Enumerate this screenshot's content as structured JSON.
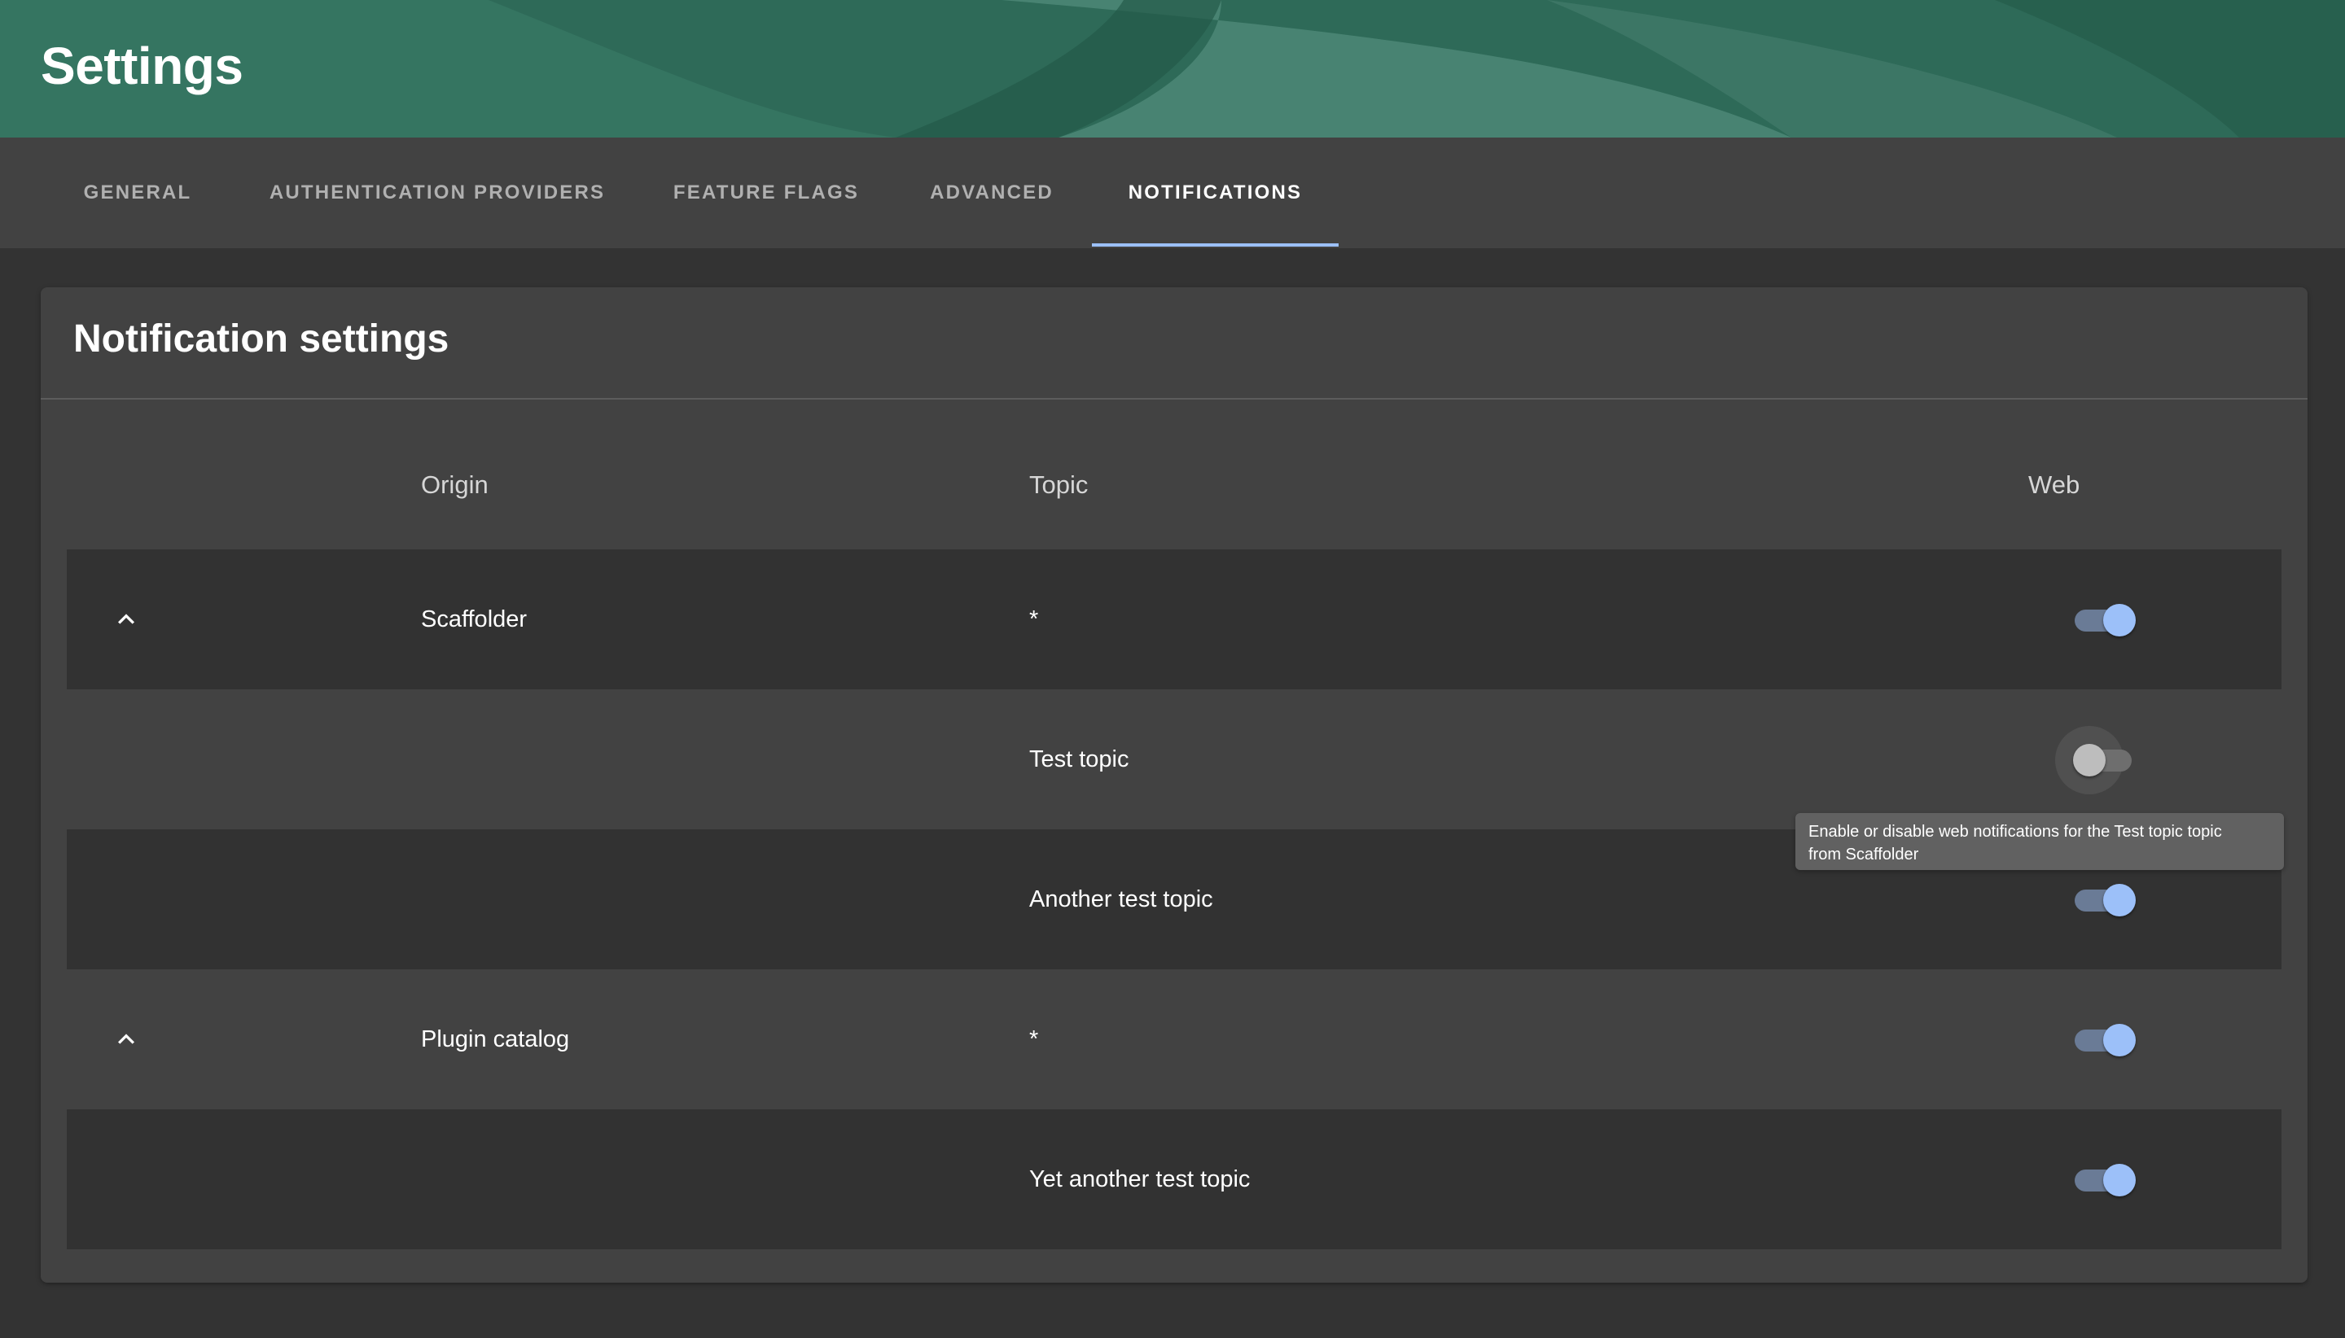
{
  "colors": {
    "header_bg": "#2e6a58",
    "accent": "#9cc0f9",
    "page_bg": "#333333",
    "card_bg": "#424242"
  },
  "header": {
    "title": "Settings"
  },
  "tabs": [
    {
      "label": "GENERAL",
      "active": false
    },
    {
      "label": "AUTHENTICATION PROVIDERS",
      "active": false
    },
    {
      "label": "FEATURE FLAGS",
      "active": false
    },
    {
      "label": "ADVANCED",
      "active": false
    },
    {
      "label": "NOTIFICATIONS",
      "active": true
    }
  ],
  "card": {
    "title": "Notification settings",
    "columns": {
      "origin": "Origin",
      "topic": "Topic",
      "web": "Web"
    },
    "rows": [
      {
        "origin": "Scaffolder",
        "topic": "*",
        "web_enabled": true,
        "expand_icon": "chevron-up-icon"
      },
      {
        "origin": "",
        "topic": "Test topic",
        "web_enabled": false
      },
      {
        "origin": "",
        "topic": "Another test topic",
        "web_enabled": true
      },
      {
        "origin": "Plugin catalog",
        "topic": "*",
        "web_enabled": true,
        "expand_icon": "chevron-up-icon"
      },
      {
        "origin": "",
        "topic": "Yet another test topic",
        "web_enabled": true
      }
    ]
  },
  "tooltip": {
    "line1": "Enable or disable web notifications for the Test topic topic",
    "line2": "from Scaffolder"
  }
}
